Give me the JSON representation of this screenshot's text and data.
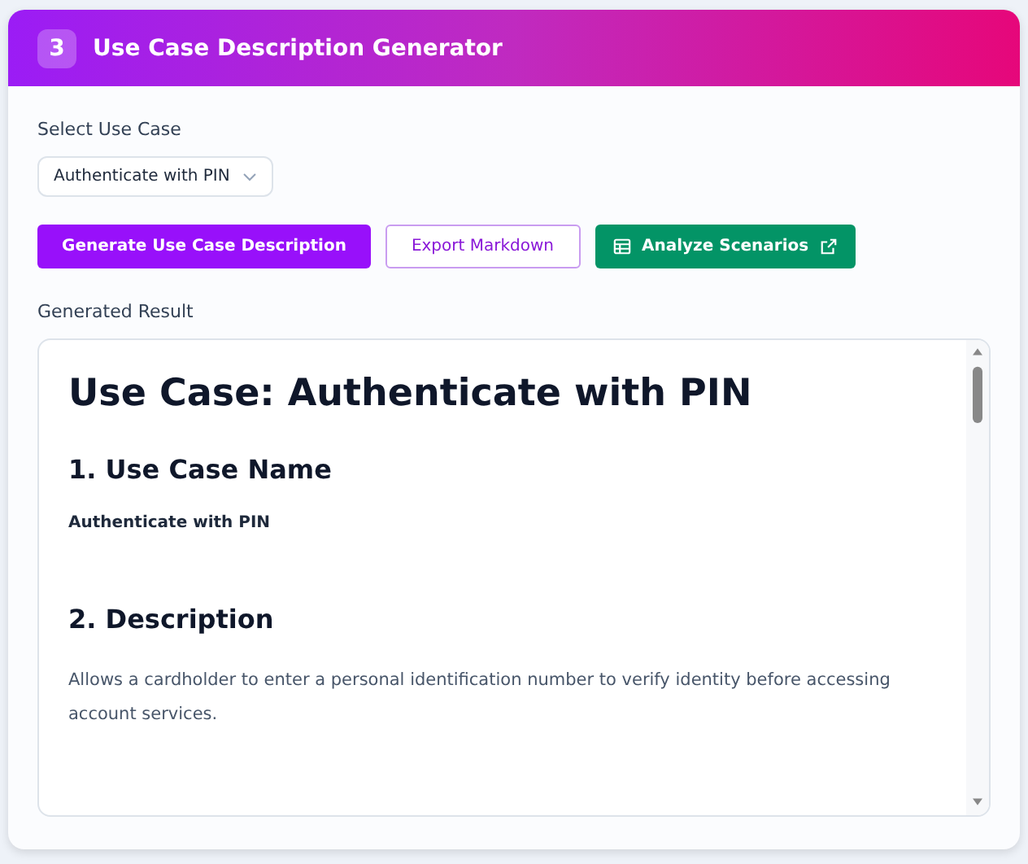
{
  "header": {
    "step": "3",
    "title": "Use Case Description Generator"
  },
  "select": {
    "label": "Select Use Case",
    "value": "Authenticate with PIN"
  },
  "buttons": [
    {
      "label": "Generate Use Case Description",
      "kind": "primary"
    },
    {
      "label": "Export Markdown",
      "kind": "outline"
    },
    {
      "label": "Analyze Scenarios",
      "kind": "success"
    }
  ],
  "result": {
    "label": "Generated Result",
    "blocks": [
      {
        "kind": "h1",
        "text": "Use Case: Authenticate with PIN"
      },
      {
        "kind": "h2",
        "text": "1. Use Case Name"
      },
      {
        "kind": "strong",
        "text": "Authenticate with PIN"
      },
      {
        "kind": "h2",
        "text": "2. Description"
      },
      {
        "kind": "p",
        "text": "Allows a cardholder to enter a personal identification number to verify identity before accessing account services."
      }
    ]
  }
}
